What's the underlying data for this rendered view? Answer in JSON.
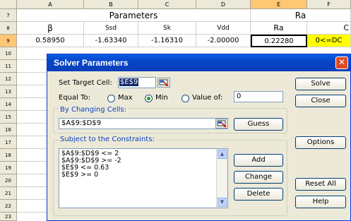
{
  "spreadsheet": {
    "columns": [
      "A",
      "B",
      "C",
      "D",
      "E",
      "F"
    ],
    "rows": [
      "7",
      "8",
      "9",
      "10",
      "11",
      "12",
      "13",
      "14",
      "15",
      "16",
      "17",
      "18",
      "19",
      "20",
      "21",
      "22",
      "23"
    ],
    "row7": {
      "parameters": "Parameters",
      "ra": "Ra"
    },
    "row8": {
      "beta": "β",
      "ssd": "Ssd",
      "sk": "Sk",
      "vdd": "Vdd",
      "ra": "Ra",
      "f": "C"
    },
    "row9": {
      "a": "0.58950",
      "b": "-1.63340",
      "c": "-1.16310",
      "d": "-2.00000",
      "e": "0.22280",
      "f": "0<=DC"
    }
  },
  "dialog": {
    "title": "Solver Parameters",
    "close_glyph": "✕",
    "set_target_label": "Set Target Cell:",
    "target_value": "$E$9",
    "equal_to_label": "Equal To:",
    "max_label": "Max",
    "min_label": "Min",
    "value_of_label": "Value of:",
    "value_of_input": "0",
    "by_changing_label": "By Changing Cells:",
    "changing_cells_value": "$A$9:$D$9",
    "guess_label": "Guess",
    "constraints_label": "Subject to the Constraints:",
    "constraints": [
      "$A$9:$D$9 <= 2",
      "$A$9:$D$9 >= -2",
      "$E$9 <= 0.63",
      "$E$9 >= 0"
    ],
    "solve_label": "Solve",
    "close_label": "Close",
    "options_label": "Options",
    "add_label": "Add",
    "change_label": "Change",
    "delete_label": "Delete",
    "reset_all_label": "Reset All",
    "help_label": "Help",
    "selected_radio": "min"
  }
}
